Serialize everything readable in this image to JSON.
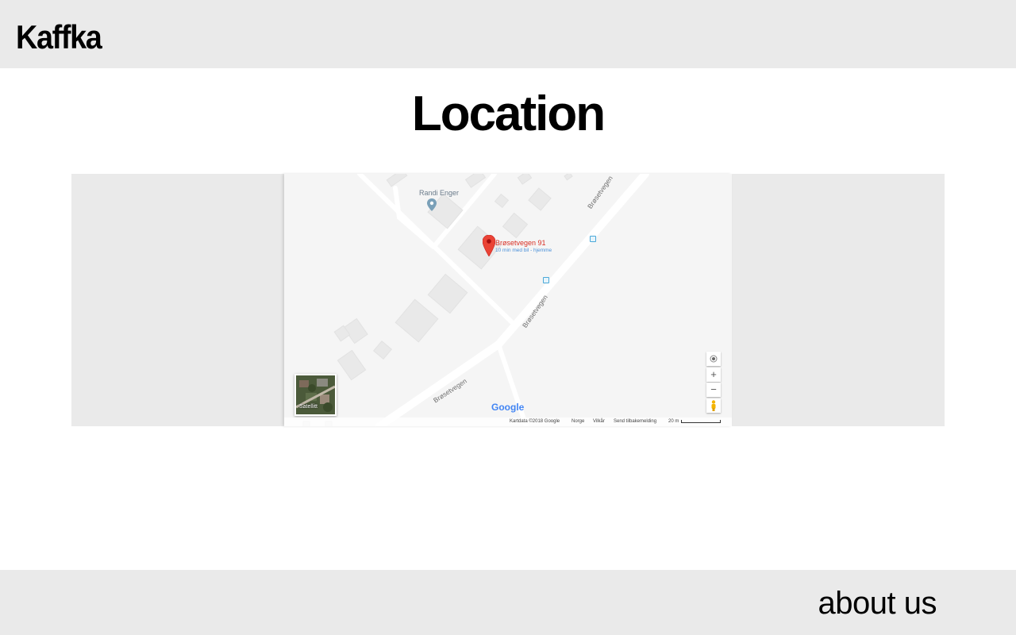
{
  "header": {
    "brand": "Kaffka"
  },
  "main": {
    "title": "Location"
  },
  "map": {
    "poi_name": "Randi Enger",
    "place_name": "Brøsetvegen 91",
    "place_subtitle": "10 min med bil - hjemme",
    "road_labels": [
      "Brøsetvegen",
      "Brøsetvegen",
      "Brøsetvegen"
    ],
    "satellite_label": "Satellitt",
    "zoom_in": "+",
    "zoom_out": "−",
    "logo": "Google",
    "footer": {
      "data": "Kartdata ©2018 Google",
      "region": "Norge",
      "terms": "Vilkår",
      "feedback": "Send tilbakemelding",
      "scale": "20 m"
    },
    "colors": {
      "marker": "#ea4335",
      "place_name": "#d93025",
      "subtitle": "#4a90d9"
    }
  },
  "footer": {
    "about": "about us"
  }
}
